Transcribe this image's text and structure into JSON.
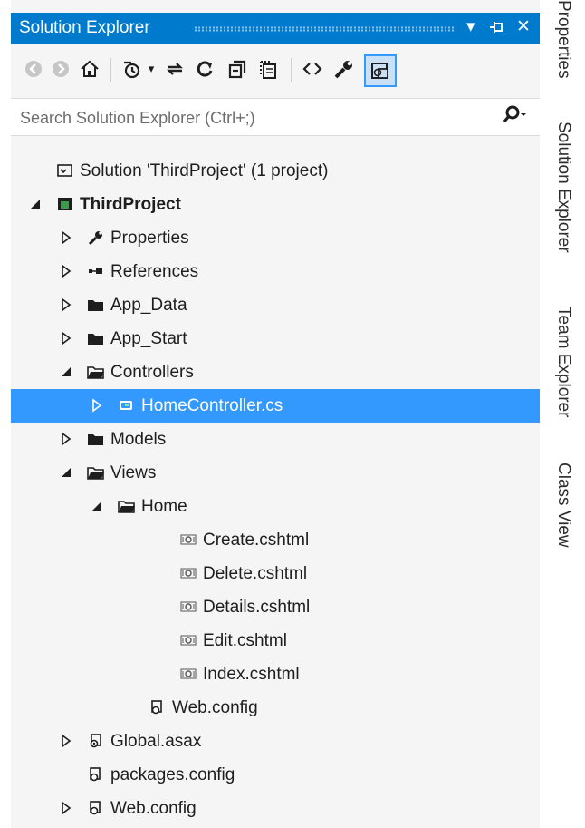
{
  "title": "Solution Explorer",
  "search": {
    "placeholder": "Search Solution Explorer (Ctrl+;)"
  },
  "tree": [
    {
      "label": "Solution 'ThirdProject' (1 project)",
      "icon": "solution-icon",
      "expander": "none"
    },
    {
      "label": "ThirdProject",
      "icon": "project-icon",
      "expander": "expanded",
      "bold": true
    },
    {
      "label": "Properties",
      "icon": "wrench-icon",
      "expander": "collapsed"
    },
    {
      "label": "References",
      "icon": "references-icon",
      "expander": "collapsed"
    },
    {
      "label": "App_Data",
      "icon": "folder-icon",
      "expander": "collapsed"
    },
    {
      "label": "App_Start",
      "icon": "folder-icon",
      "expander": "collapsed"
    },
    {
      "label": "Controllers",
      "icon": "folder-open-icon",
      "expander": "expanded"
    },
    {
      "label": "HomeController.cs",
      "icon": "csharp-file-icon",
      "expander": "collapsed",
      "selected": true
    },
    {
      "label": "Models",
      "icon": "folder-icon",
      "expander": "collapsed"
    },
    {
      "label": "Views",
      "icon": "folder-open-icon",
      "expander": "expanded"
    },
    {
      "label": "Home",
      "icon": "folder-open-icon",
      "expander": "expanded"
    },
    {
      "label": "Create.cshtml",
      "icon": "razor-file-icon",
      "expander": "none"
    },
    {
      "label": "Delete.cshtml",
      "icon": "razor-file-icon",
      "expander": "none"
    },
    {
      "label": "Details.cshtml",
      "icon": "razor-file-icon",
      "expander": "none"
    },
    {
      "label": "Edit.cshtml",
      "icon": "razor-file-icon",
      "expander": "none"
    },
    {
      "label": "Index.cshtml",
      "icon": "razor-file-icon",
      "expander": "none"
    },
    {
      "label": "Web.config",
      "icon": "config-file-icon",
      "expander": "none"
    },
    {
      "label": "Global.asax",
      "icon": "asax-file-icon",
      "expander": "collapsed"
    },
    {
      "label": "packages.config",
      "icon": "config-file-icon",
      "expander": "none"
    },
    {
      "label": "Web.config",
      "icon": "config-file-icon",
      "expander": "collapsed"
    }
  ],
  "side_tabs": [
    "Properties",
    "Solution Explorer",
    "Team Explorer",
    "Class View"
  ],
  "colors": {
    "accent": "#007acc",
    "selection": "#3399ff",
    "panel": "#f5f5f5"
  }
}
